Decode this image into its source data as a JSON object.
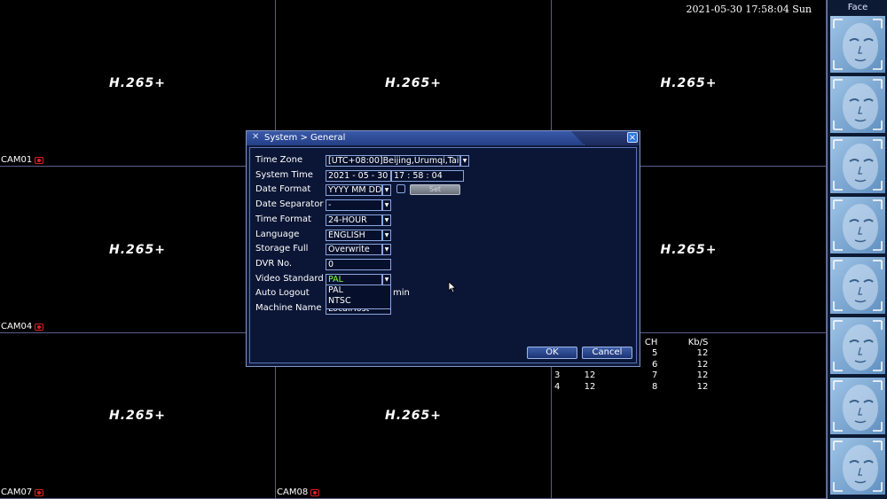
{
  "datetime": "2021-05-30 17:58:04 Sun",
  "cameras": [
    {
      "codec": "H.265+",
      "label": "CAM01"
    },
    {
      "codec": "H.265+",
      "label": ""
    },
    {
      "codec": "H.265+",
      "label": ""
    },
    {
      "codec": "H.265+",
      "label": "CAM04"
    },
    {
      "codec": "",
      "label": ""
    },
    {
      "codec": "H.265+",
      "label": ""
    },
    {
      "codec": "H.265+",
      "label": "CAM07"
    },
    {
      "codec": "H.265+",
      "label": "CAM08"
    },
    {
      "codec": "",
      "label": ""
    }
  ],
  "face_panel": {
    "title": "Face"
  },
  "dialog": {
    "title": "System > General",
    "close_icon": "close-icon",
    "fields": {
      "time_zone": {
        "label": "Time Zone",
        "value": "[UTC+08:00]Beijing,Urumqi,Tai"
      },
      "system_time": {
        "label": "System Time",
        "date": "2021 - 05 - 30",
        "time": "17 : 58 : 04"
      },
      "date_format": {
        "label": "Date Format",
        "value": "YYYY MM DD",
        "set_label": "Set"
      },
      "date_separator": {
        "label": "Date Separator",
        "value": "-"
      },
      "time_format": {
        "label": "Time Format",
        "value": "24-HOUR"
      },
      "language": {
        "label": "Language",
        "value": "ENGLISH"
      },
      "storage_full": {
        "label": "Storage Full",
        "value": "Overwrite"
      },
      "dvr_no": {
        "label": "DVR No.",
        "value": "0"
      },
      "video_standard": {
        "label": "Video Standard",
        "value": "PAL",
        "options": [
          "PAL",
          "NTSC"
        ]
      },
      "auto_logout": {
        "label": "Auto Logout",
        "unit": "min"
      },
      "machine_name": {
        "label": "Machine Name",
        "value": "LocalHost"
      }
    },
    "ok_label": "OK",
    "cancel_label": "Cancel"
  },
  "stats": {
    "headers": [
      "CH",
      "Kb/S",
      "CH",
      "Kb/S"
    ],
    "rows": [
      [
        "",
        "",
        "5",
        "12"
      ],
      [
        "",
        "",
        "6",
        "12"
      ],
      [
        "3",
        "12",
        "7",
        "12"
      ],
      [
        "4",
        "12",
        "8",
        "12"
      ]
    ]
  },
  "colors": {
    "accent": "#2f76d8",
    "rec": "#e02020",
    "grid_line": "#5a5e8a",
    "dialog_bg": "#101a3a",
    "selected_text": "#8cff4a"
  }
}
